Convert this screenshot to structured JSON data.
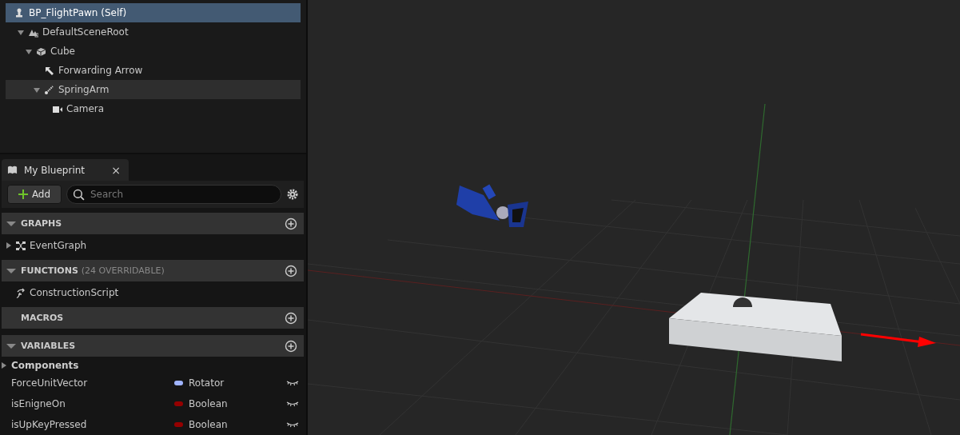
{
  "components_tree": [
    {
      "label": "BP_FlightPawn (Self)",
      "kind": "pawn",
      "selected": true,
      "hovered": false,
      "children": [
        {
          "label": "DefaultSceneRoot",
          "kind": "scene-root",
          "selected": false,
          "hovered": false,
          "expanded": true,
          "children": [
            {
              "label": "Cube",
              "kind": "cube",
              "selected": false,
              "hovered": false,
              "expanded": true,
              "children": [
                {
                  "label": "Forwarding Arrow",
                  "kind": "arrow",
                  "selected": false,
                  "hovered": false
                },
                {
                  "label": "SpringArm",
                  "kind": "spring-arm",
                  "selected": false,
                  "hovered": true,
                  "expanded": true,
                  "children": [
                    {
                      "label": "Camera",
                      "kind": "camera",
                      "selected": false,
                      "hovered": false
                    }
                  ]
                }
              ]
            }
          ]
        }
      ]
    }
  ],
  "my_blueprint": {
    "tab": {
      "label": "My Blueprint",
      "close": "×"
    },
    "add_button": "Add",
    "search": {
      "placeholder": "Search"
    },
    "sections": [
      {
        "title": "GRAPHS",
        "expanded": true,
        "items": [
          {
            "label": "EventGraph",
            "kind": "graph",
            "expandable": true
          }
        ]
      },
      {
        "title": "FUNCTIONS",
        "note": "(24 OVERRIDABLE)",
        "expanded": true,
        "items": [
          {
            "label": "ConstructionScript",
            "kind": "function"
          }
        ]
      },
      {
        "title": "MACROS",
        "expanded": false
      },
      {
        "title": "VARIABLES",
        "expanded": true,
        "category": "Components",
        "variables": [
          {
            "name": "ForceUnitVector",
            "type": "Rotator",
            "color": "#a0b4ff"
          },
          {
            "name": "isEnigneOn",
            "type": "Boolean",
            "color": "#950000"
          },
          {
            "name": "isUpKeyPressed",
            "type": "Boolean",
            "color": "#950000"
          }
        ]
      }
    ]
  }
}
